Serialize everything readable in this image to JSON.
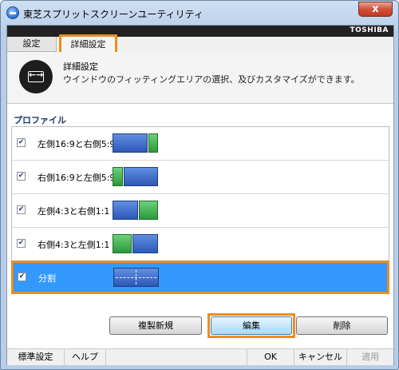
{
  "window": {
    "title": "東芝スプリットスクリーンユーティリティ",
    "close_label": "x",
    "brand": "TOSHIBA"
  },
  "tabs": [
    {
      "label": "設定"
    },
    {
      "label": "詳細設定"
    }
  ],
  "header": {
    "icon": "fit-arrows-icon",
    "title": "詳細設定",
    "description": "ウインドウのフィッティングエリアの選択、及びカスタマイズができます。"
  },
  "profiles": {
    "section_label": "プロファイル",
    "items": [
      {
        "label": "左側16:9と右側5:9",
        "checked": true,
        "layout": "wide-left-narrow-right"
      },
      {
        "label": "右側16:9と左側5:9",
        "checked": true,
        "layout": "narrow-left-wide-right"
      },
      {
        "label": "左側4:3と右側1:1",
        "checked": true,
        "layout": "left-4-3-right-1-1"
      },
      {
        "label": "右側4:3と左側1:1",
        "checked": true,
        "layout": "left-1-1-right-4-3"
      },
      {
        "label": "分割",
        "checked": true,
        "layout": "split-quad",
        "selected": true
      }
    ]
  },
  "actions": {
    "copy_new": "複製新規",
    "edit": "編集",
    "delete": "削除"
  },
  "footer": {
    "defaults": "標準設定",
    "help": "ヘルプ",
    "ok": "OK",
    "cancel": "キャンセル",
    "apply": "適用"
  },
  "colors": {
    "selection": "#3399ff",
    "highlight": "#ee8c20",
    "pane_blue": "#2e57b8",
    "pane_green": "#2a9a3a"
  }
}
